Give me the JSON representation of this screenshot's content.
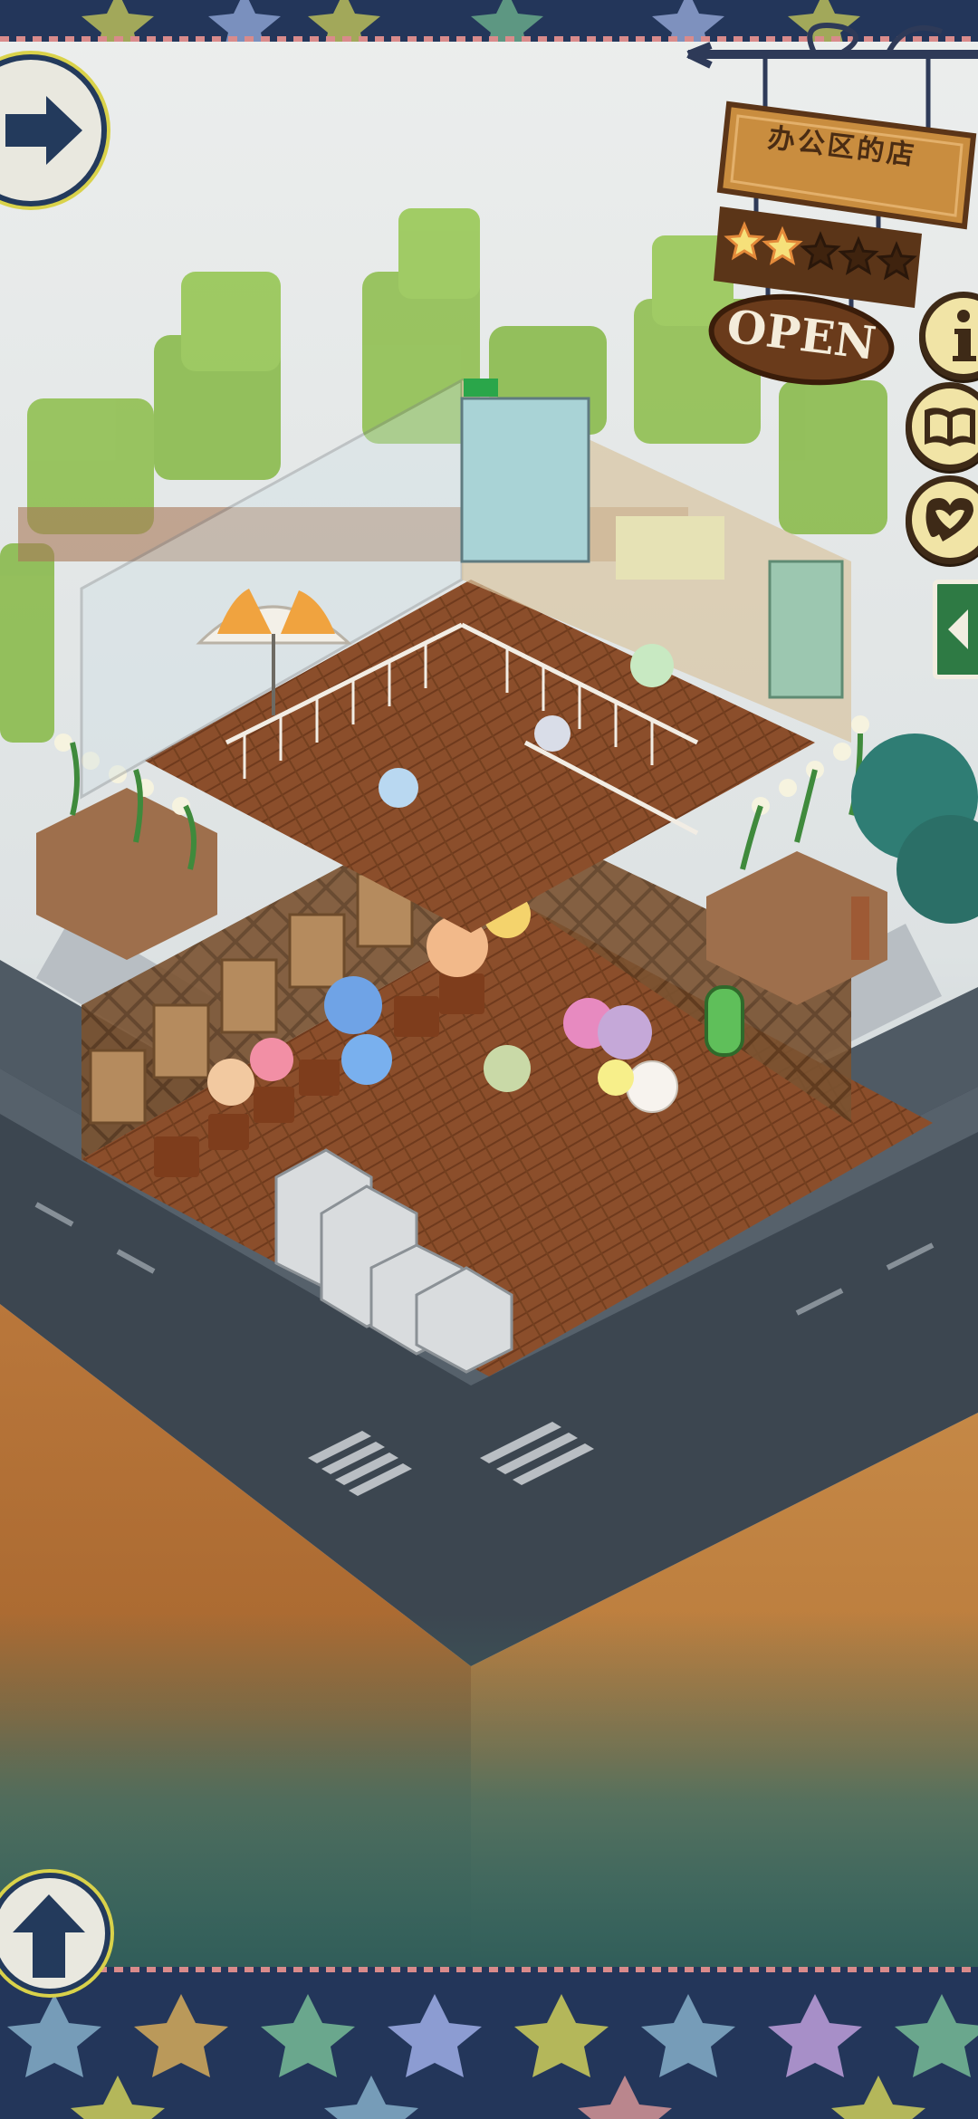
{
  "shop": {
    "name": "办公区的店",
    "status": "OPEN",
    "rating": 2,
    "rating_max": 5
  },
  "icons": {
    "forward": "arrow-right-icon",
    "up": "arrow-up-icon",
    "info": "info-icon",
    "book": "book-icon",
    "heart": "heart-icon",
    "collapse": "arrow-left-icon"
  },
  "colors": {
    "banner": "#23365a",
    "sign_wood": "#c98d3f",
    "sign_dark": "#5b3518",
    "floor": "#8a4f2c",
    "road": "#4d5863",
    "side_tab": "#2e7a44"
  }
}
